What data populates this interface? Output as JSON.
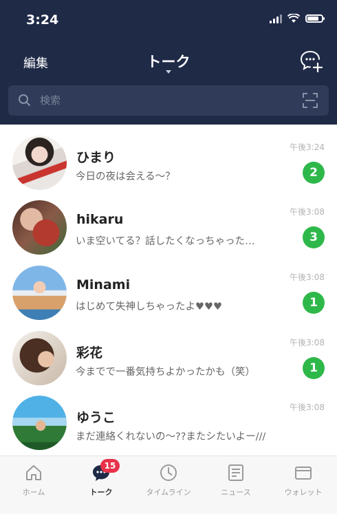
{
  "status_bar": {
    "time": "3:24"
  },
  "nav": {
    "edit_label": "編集",
    "title": "トーク"
  },
  "search": {
    "placeholder": "検索"
  },
  "chats": [
    {
      "name": "ひまり",
      "message": "今日の夜は会える〜？",
      "time": "午後3:24",
      "unread": "2"
    },
    {
      "name": "hikaru",
      "message": "いま空いてる？話したくなっちゃった…",
      "time": "午後3:08",
      "unread": "3"
    },
    {
      "name": "Minami",
      "message": "はじめて失神しちゃったよ♥♥♥",
      "time": "午後3:08",
      "unread": "1"
    },
    {
      "name": "彩花",
      "message": "今までで一番気持ちよかったかも（笑）",
      "time": "午後3:08",
      "unread": "1"
    },
    {
      "name": "ゆうこ",
      "message": "まだ連絡くれないの〜??またシたいよー///",
      "time": "午後3:08",
      "unread": ""
    }
  ],
  "tabs": [
    {
      "label": "ホーム",
      "icon": "home-icon"
    },
    {
      "label": "トーク",
      "icon": "chat-icon",
      "badge": "15",
      "active": true
    },
    {
      "label": "タイムライン",
      "icon": "clock-icon"
    },
    {
      "label": "ニュース",
      "icon": "news-icon"
    },
    {
      "label": "ウォレット",
      "icon": "wallet-icon"
    }
  ],
  "colors": {
    "header_bg": "#1f2a47",
    "unread_badge": "#2fb84a",
    "tab_badge": "#e8324a"
  }
}
